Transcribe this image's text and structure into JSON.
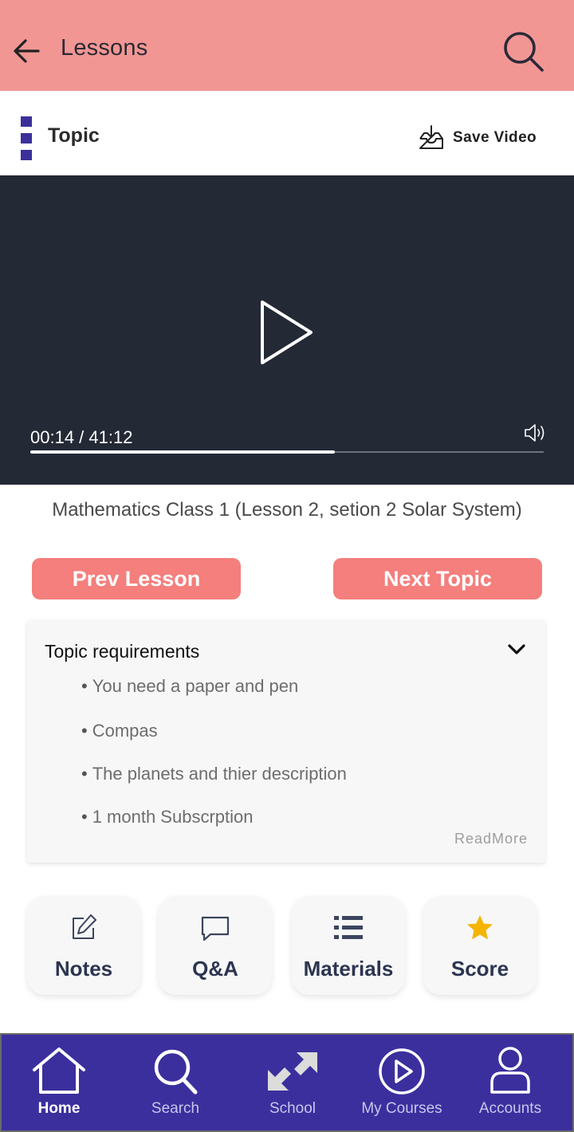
{
  "header": {
    "title": "Lessons"
  },
  "topic_bar": {
    "title": "Topic",
    "save_label": "Save Video"
  },
  "player": {
    "time": "00:14 / 41:12",
    "progress": 0.593
  },
  "video_title": "Mathematics Class 1 (Lesson 2, setion 2  Solar System)",
  "buttons": {
    "prev": "Prev Lesson",
    "next": "Next Topic"
  },
  "requirements": {
    "title": "Topic requirements",
    "items": [
      "You need a paper and pen",
      "Compas",
      "The planets and thier description",
      "1 month Subscrption"
    ],
    "read_more": "ReadMore"
  },
  "cards": [
    {
      "label": "Notes",
      "icon": "edit-icon"
    },
    {
      "label": "Q&A",
      "icon": "chat-icon"
    },
    {
      "label": "Materials",
      "icon": "list-icon"
    },
    {
      "label": "Score",
      "icon": "star-icon"
    }
  ],
  "nav": [
    {
      "label": "Home",
      "icon": "home-icon",
      "active": true
    },
    {
      "label": "Search",
      "icon": "search-icon"
    },
    {
      "label": "School",
      "icon": "expand-arrows-icon"
    },
    {
      "label": "My Courses",
      "icon": "play-circle-icon"
    },
    {
      "label": "Accounts",
      "icon": "user-icon"
    }
  ],
  "colors": {
    "header_bg": "#f29694",
    "accent": "#3b3099",
    "button_bg": "#f47f7d",
    "player_bg": "#232935",
    "nav_bg": "#3b2f9e",
    "star": "#f5b400"
  }
}
